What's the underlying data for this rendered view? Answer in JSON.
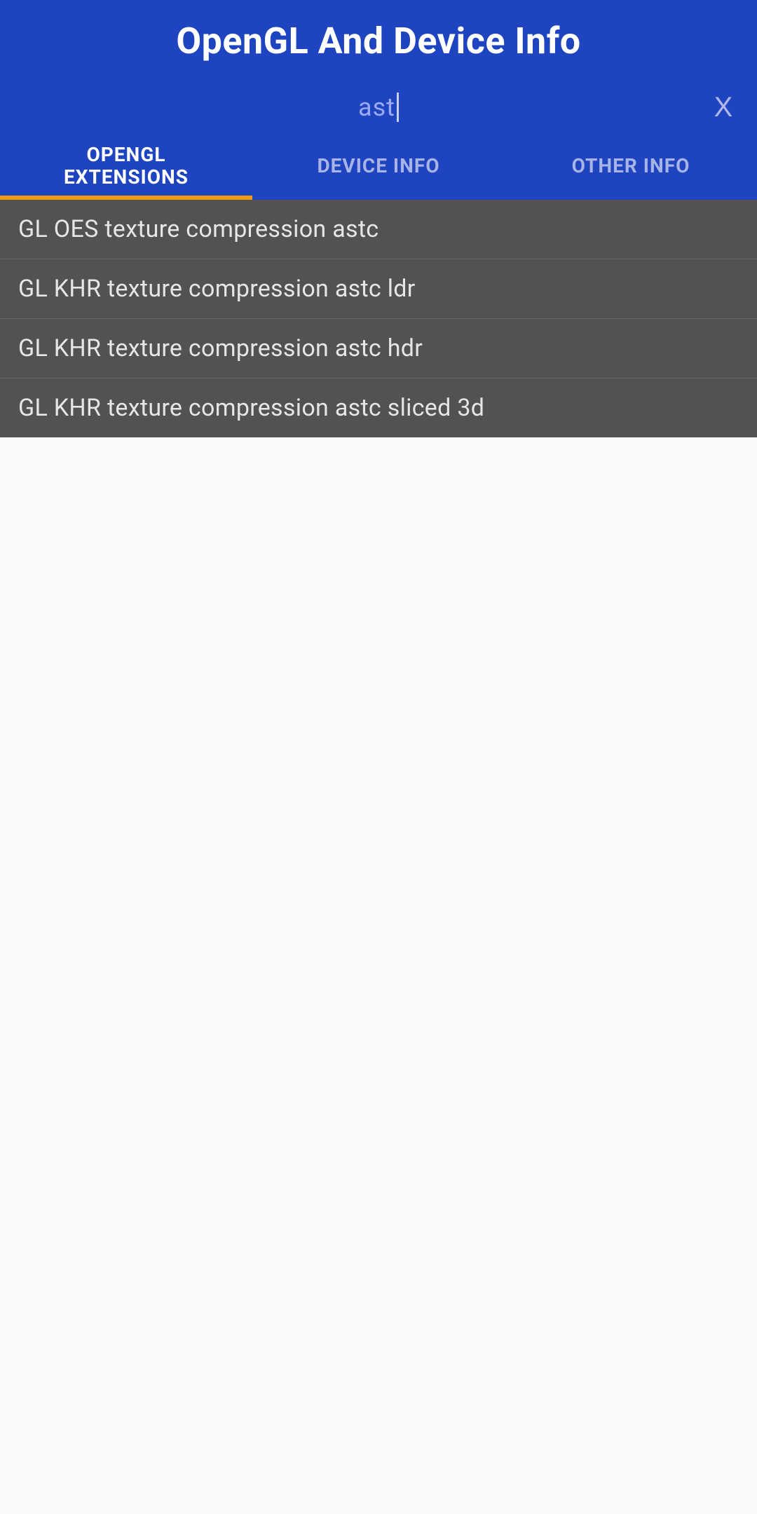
{
  "header": {
    "title": "OpenGL And Device Info"
  },
  "search": {
    "value": "ast",
    "clear_icon": "X"
  },
  "tabs": [
    {
      "label": "OPENGL\nEXTENSIONS",
      "active": true
    },
    {
      "label": "DEVICE INFO",
      "active": false
    },
    {
      "label": "OTHER INFO",
      "active": false
    }
  ],
  "list": {
    "items": [
      "GL OES texture compression astc",
      "GL KHR texture compression astc ldr",
      "GL KHR texture compression astc hdr",
      "GL KHR texture compression astc sliced 3d"
    ]
  }
}
